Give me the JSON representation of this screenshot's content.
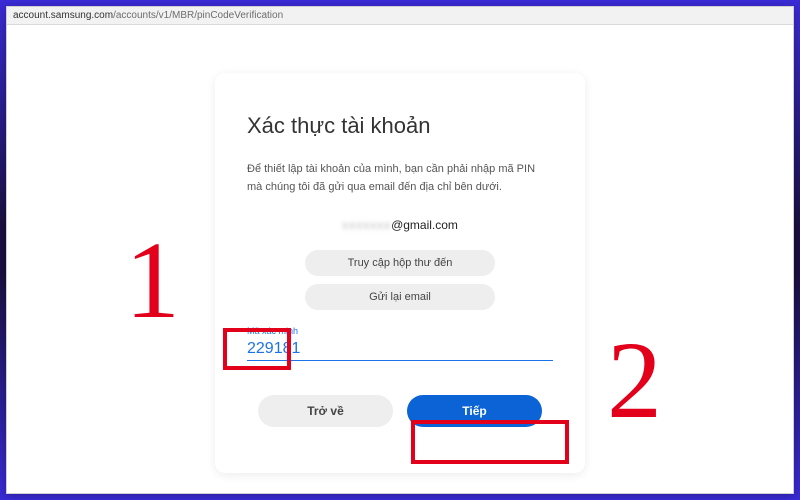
{
  "address_bar": {
    "host": "account.samsung.com",
    "path": "/accounts/v1/MBR/pinCodeVerification"
  },
  "card": {
    "title": "Xác thực tài khoản",
    "description": "Để thiết lập tài khoản của mình, bạn cần phải nhập mã PIN mà chúng tôi đã gửi qua email đến địa chỉ bên dưới.",
    "email_masked_prefix": "xxxxxxx",
    "email_domain": "@gmail.com",
    "inbox_button": "Truy cập hộp thư đến",
    "resend_button": "Gửi lại email",
    "code_label": "Mã xác minh",
    "code_value": "229181",
    "back_button": "Trở về",
    "next_button": "Tiếp"
  },
  "annotations": {
    "step1": "1",
    "step2": "2"
  }
}
